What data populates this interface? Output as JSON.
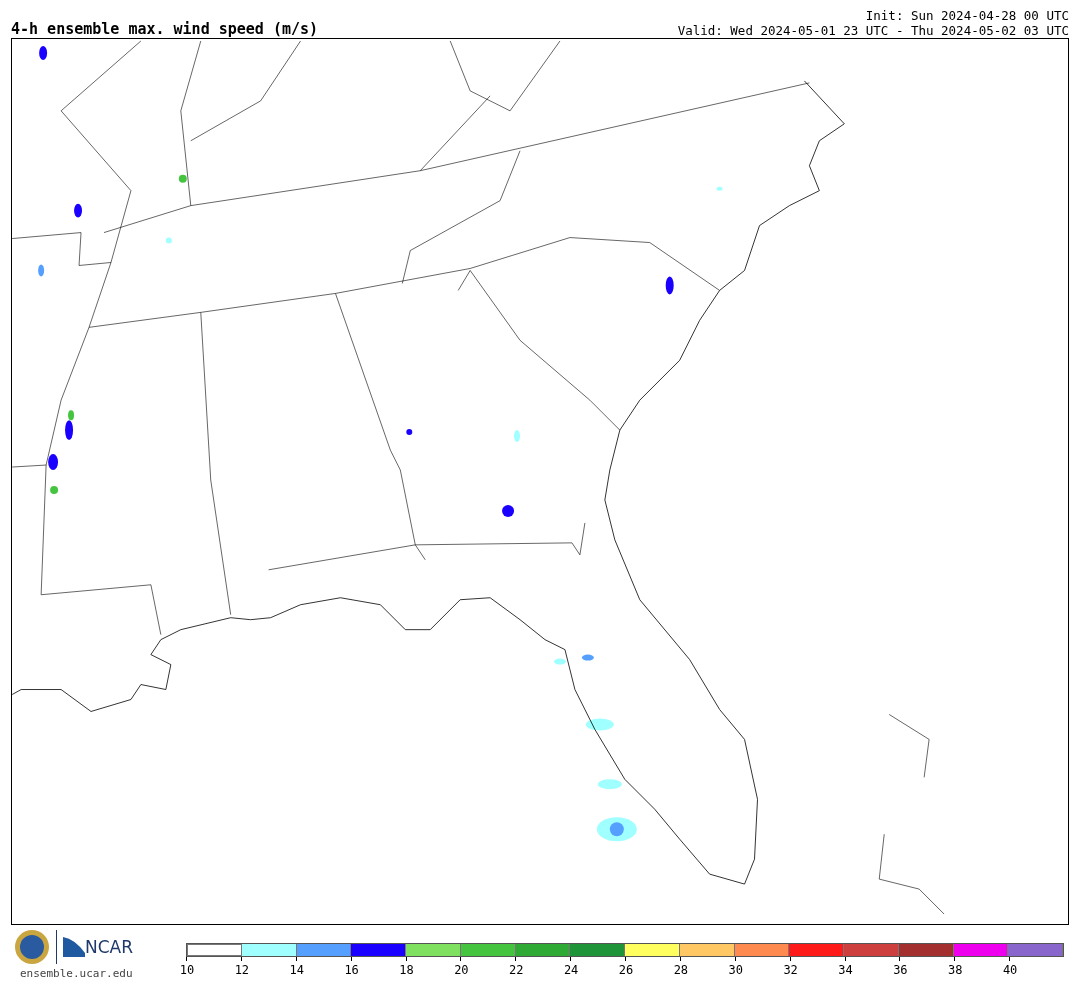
{
  "title": "4-h ensemble max. wind speed (m/s)",
  "init": "Init: Sun 2024-04-28 00 UTC",
  "valid": "Valid: Wed 2024-05-01 23 UTC - Thu 2024-05-02 03 UTC",
  "footer": {
    "logo_text": "NCAR",
    "website": "ensemble.ucar.edu"
  },
  "colorbar": {
    "segments": [
      {
        "color": "#ffffff",
        "tick": "10"
      },
      {
        "color": "#a0ffff",
        "tick": "12"
      },
      {
        "color": "#55a0ff",
        "tick": "14"
      },
      {
        "color": "#1a00ff",
        "tick": "16"
      },
      {
        "color": "#80e060",
        "tick": "18"
      },
      {
        "color": "#45c440",
        "tick": "20"
      },
      {
        "color": "#2eaa35",
        "tick": "22"
      },
      {
        "color": "#1f9438",
        "tick": "24"
      },
      {
        "color": "#ffff60",
        "tick": "26"
      },
      {
        "color": "#ffc864",
        "tick": "28"
      },
      {
        "color": "#ff8a50",
        "tick": "30"
      },
      {
        "color": "#ff1a1a",
        "tick": "32"
      },
      {
        "color": "#cd3f3f",
        "tick": "34"
      },
      {
        "color": "#a32f2f",
        "tick": "36"
      },
      {
        "color": "#ee00ee",
        "tick": "38"
      },
      {
        "color": "#8866cc",
        "tick": "40"
      }
    ]
  }
}
